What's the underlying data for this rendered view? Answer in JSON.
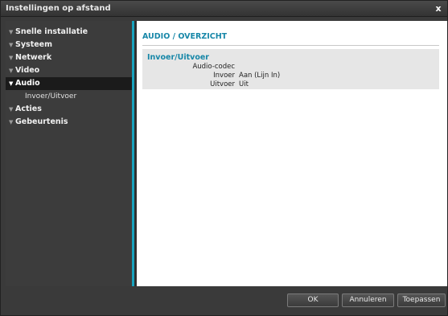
{
  "window": {
    "title": "Instellingen op afstand",
    "close_glyph": "x"
  },
  "sidebar": {
    "items": [
      {
        "label": "Snelle installatie"
      },
      {
        "label": "Systeem"
      },
      {
        "label": "Netwerk"
      },
      {
        "label": "Video"
      },
      {
        "label": "Audio",
        "active": true,
        "children": [
          {
            "label": "Invoer/Uitvoer"
          }
        ]
      },
      {
        "label": "Acties"
      },
      {
        "label": "Gebeurtenis"
      }
    ],
    "arrow_glyph": "▼"
  },
  "content": {
    "title": "AUDIO / OVERZICHT",
    "panel": {
      "title": "Invoer/Uitvoer",
      "rows": [
        {
          "label": "Audio-codec",
          "value": ""
        },
        {
          "label": "Invoer",
          "value": "Aan (Lijn In)"
        },
        {
          "label": "Uitvoer",
          "value": "Uit"
        }
      ]
    }
  },
  "footer": {
    "ok_label": "OK",
    "cancel_label": "Annuleren",
    "apply_label": "Toepassen"
  },
  "colors": {
    "accent": "#17a2bd",
    "heading": "#1787a8"
  },
  "icons": {
    "close": "close-icon",
    "expand": "triangle-down-icon"
  }
}
